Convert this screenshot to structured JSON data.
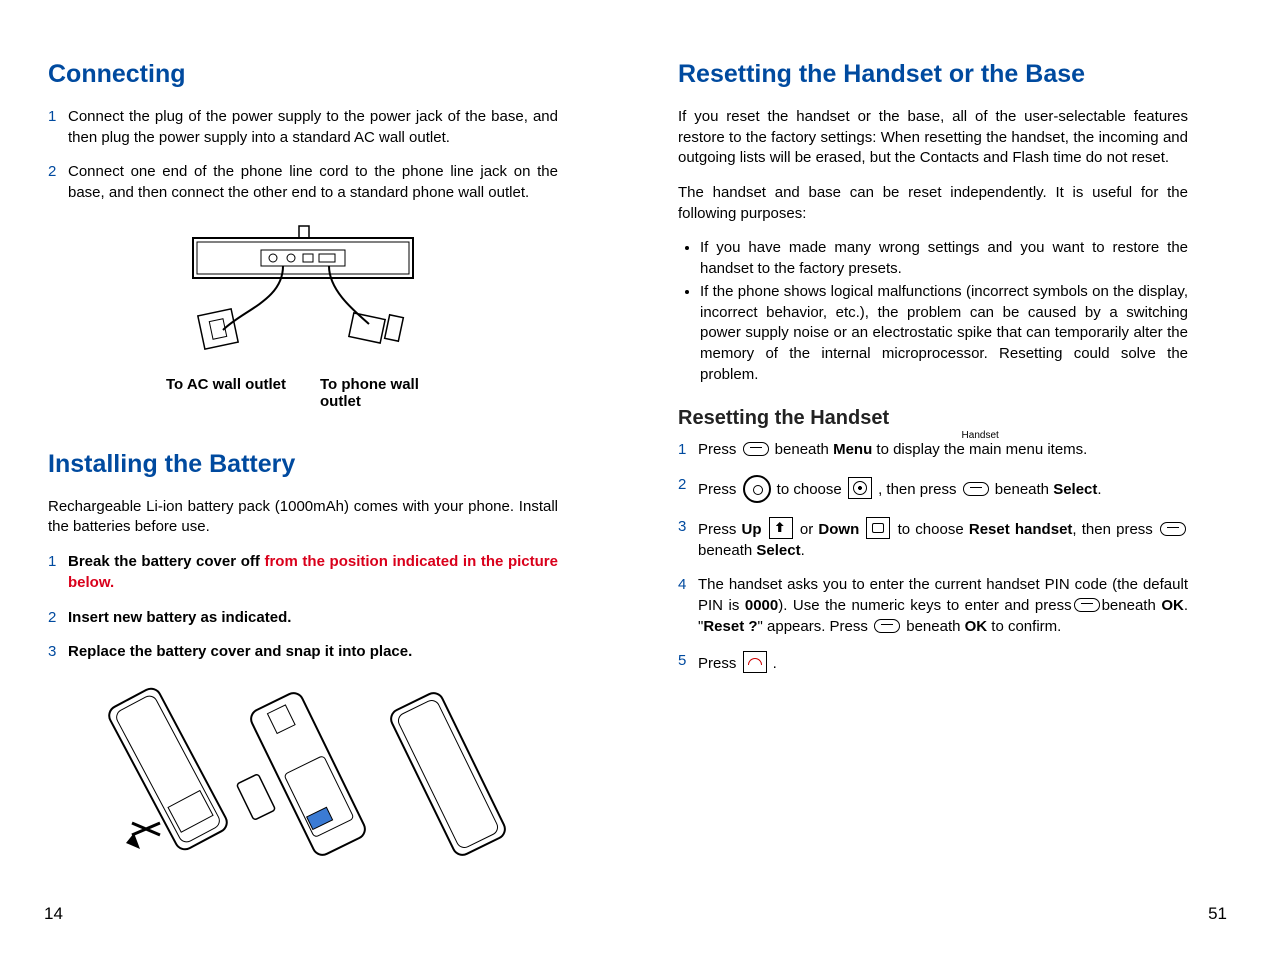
{
  "left": {
    "connecting": {
      "title": "Connecting",
      "steps": [
        "Connect the plug of the power supply to the power jack of the base, and then plug the power supply into a standard AC wall outlet.",
        "Connect one end of the phone line cord to the phone line jack on the base, and then connect the other end to a standard phone wall outlet."
      ],
      "fig_label_ac": "To AC wall outlet",
      "fig_label_phone": "To phone wall outlet"
    },
    "battery": {
      "title": "Installing the Battery",
      "intro": "Rechargeable Li-ion battery pack (1000mAh) comes with your phone. Install the batteries before use.",
      "steps": [
        {
          "pre": "Break the battery cover off ",
          "highlight": "from the position indicated in the picture below."
        },
        {
          "pre": "Insert new battery as indicated.",
          "highlight": ""
        },
        {
          "pre": "Replace the battery cover and snap it into place.",
          "highlight": ""
        }
      ]
    },
    "page_num": "14"
  },
  "right": {
    "resetting": {
      "title": "Resetting the Handset or the Base",
      "para1": "If you reset the handset or the base, all of the user-selectable features restore to the factory settings: When resetting the handset, the incoming and outgoing lists will be erased, but the Contacts and Flash time do not reset.",
      "para2": "The handset and base can be reset independently. It is useful for the following purposes:",
      "bullets": [
        "If you have made many wrong settings and you want to restore the handset to the factory presets.",
        "If the phone shows logical malfunctions (incorrect symbols on the display, incorrect behavior, etc.), the problem can be caused by a switching power supply noise or an electrostatic spike that can temporarily alter the memory of the internal microprocessor. Resetting could solve the problem."
      ]
    },
    "handset_reset": {
      "title": "Resetting the Handset",
      "step1_a": "Press ",
      "step1_b": " beneath ",
      "step1_menu": "Menu",
      "step1_c": " to display the main menu items.",
      "step1_handset_label": "Handset",
      "step2_a": "Press ",
      "step2_b": " to choose ",
      "step2_c": " , then press ",
      "step2_d": " beneath ",
      "step2_select": "Select",
      "step3_a": "Press ",
      "step3_up": "Up",
      "step3_b": " or ",
      "step3_down": "Down",
      "step3_c": " to choose ",
      "step3_reset": "Reset handset",
      "step3_d": ", then press ",
      "step3_e": " beneath ",
      "step3_select": "Select",
      "step4_a": "The handset asks you to enter the current handset PIN code (the default PIN is ",
      "step4_pin": "0000",
      "step4_b": "). Use the numeric keys to enter and press",
      "step4_c": "beneath ",
      "step4_ok": "OK",
      "step4_d": ". \"",
      "step4_reset": "Reset ?",
      "step4_e": "\" appears. Press ",
      "step4_f": " beneath ",
      "step4_ok2": "OK",
      "step4_g": " to confirm.",
      "step5_a": "Press ",
      "step5_b": " ."
    },
    "page_num": "51"
  }
}
